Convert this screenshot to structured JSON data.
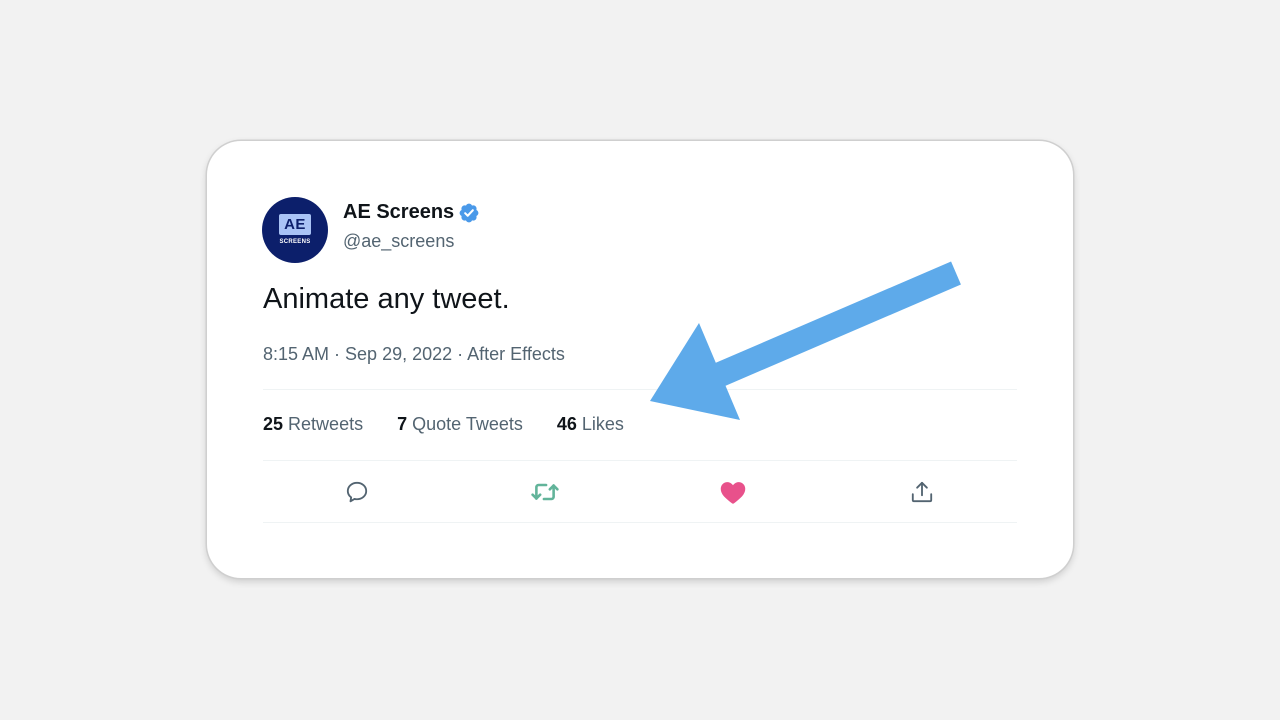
{
  "author": {
    "display_name": "AE Screens",
    "handle": "@ae_screens",
    "avatar_text": "AE",
    "avatar_subtext": "SCREENS",
    "verified_icon": "verified-badge-icon"
  },
  "tweet": {
    "text": "Animate any tweet.",
    "meta": "8:15 AM · Sep 29, 2022 · After Effects"
  },
  "stats": {
    "retweets_count": "25",
    "retweets_label": "Retweets",
    "quotes_count": "7",
    "quotes_label": "Quote Tweets",
    "likes_count": "46",
    "likes_label": "Likes"
  },
  "actions": {
    "reply_icon": "reply-icon",
    "retweet_icon": "retweet-icon",
    "like_icon": "heart-icon",
    "share_icon": "share-icon"
  },
  "colors": {
    "page_bg": "#f2f2f2",
    "verified": "#4a99e9",
    "retweet_green": "#62b49a",
    "like_pink": "#e8518b",
    "arrow_blue": "#5eaaea",
    "avatar_bg": "#0c1f6b"
  }
}
